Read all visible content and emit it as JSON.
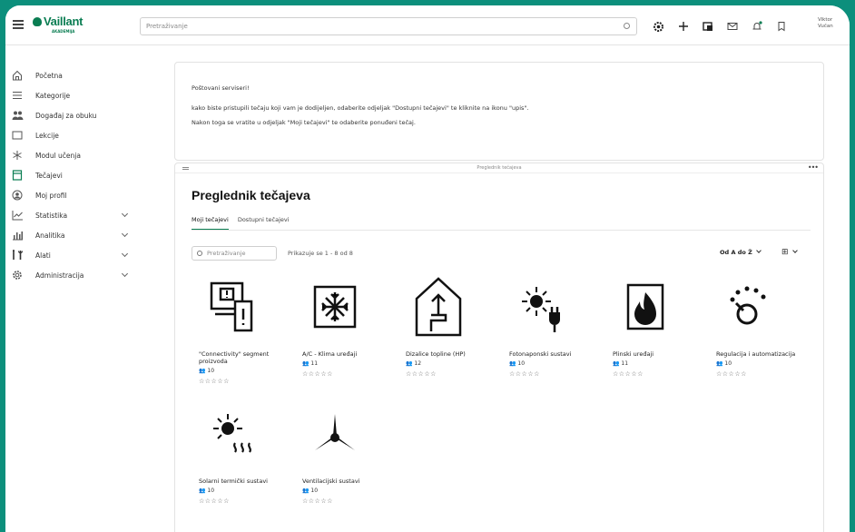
{
  "header": {
    "logo": "Vaillant",
    "logo_sub": "AKADEMIJA",
    "search_placeholder": "Pretraživanje",
    "user_line1": "Viktor",
    "user_line2": "Vučan"
  },
  "sidebar": {
    "items": [
      {
        "label": "Početna"
      },
      {
        "label": "Kategorije"
      },
      {
        "label": "Događaj za obuku"
      },
      {
        "label": "Lekcije"
      },
      {
        "label": "Modul učenja"
      },
      {
        "label": "Tečajevi"
      },
      {
        "label": "Moj profil"
      },
      {
        "label": "Statistika"
      },
      {
        "label": "Analitika"
      },
      {
        "label": "Alati"
      },
      {
        "label": "Administracija"
      }
    ]
  },
  "notice": {
    "greeting": "Poštovani serviseri!",
    "line1": "kako biste pristupili tečaju koji vam je dodijeljen, odaberite odjeljak \"Dostupni tečajevi\" te kliknite na ikonu \"upis\".",
    "line2": "Nakon toga se vratite u odjeljak \"Moji tečajevi\" te odaberite ponuđeni tečaj."
  },
  "panel": {
    "bar_title": "Preglednik tečajeva",
    "more": "•••",
    "title": "Preglednik tečajeva",
    "tabs": [
      "Moji tečajevi",
      "Dostupni tečajevi"
    ],
    "search_placeholder": "Pretraživanje",
    "showing": "Prikazuje se 1 - 8 od 8",
    "sort_label": "Od A do Ž",
    "view_icon": "⊞"
  },
  "courses": [
    {
      "title": "\"Connectivity\" segment proizvoda",
      "count": "10",
      "stars": "☆☆☆☆☆",
      "icon": "connectivity-icon"
    },
    {
      "title": "A/C - Klima uređaji",
      "count": "11",
      "stars": "☆☆☆☆☆",
      "icon": "snowflake-icon"
    },
    {
      "title": "Dizalice topline (HP)",
      "count": "12",
      "stars": "☆☆☆☆☆",
      "icon": "heat-pump-icon"
    },
    {
      "title": "Fotonaponski sustavi",
      "count": "10",
      "stars": "☆☆☆☆☆",
      "icon": "solar-plug-icon"
    },
    {
      "title": "Plinski uređaji",
      "count": "11",
      "stars": "☆☆☆☆☆",
      "icon": "flame-icon"
    },
    {
      "title": "Regulacija i automatizacija",
      "count": "10",
      "stars": "☆☆☆☆☆",
      "icon": "thermostat-icon"
    },
    {
      "title": "Solarni termički sustavi",
      "count": "10",
      "stars": "☆☆☆☆☆",
      "icon": "solar-thermal-icon"
    },
    {
      "title": "Ventilacijski sustavi",
      "count": "10",
      "stars": "☆☆☆☆☆",
      "icon": "fan-icon"
    }
  ],
  "colors": {
    "brand": "#0a7d52",
    "background": "#0c8f7c"
  }
}
